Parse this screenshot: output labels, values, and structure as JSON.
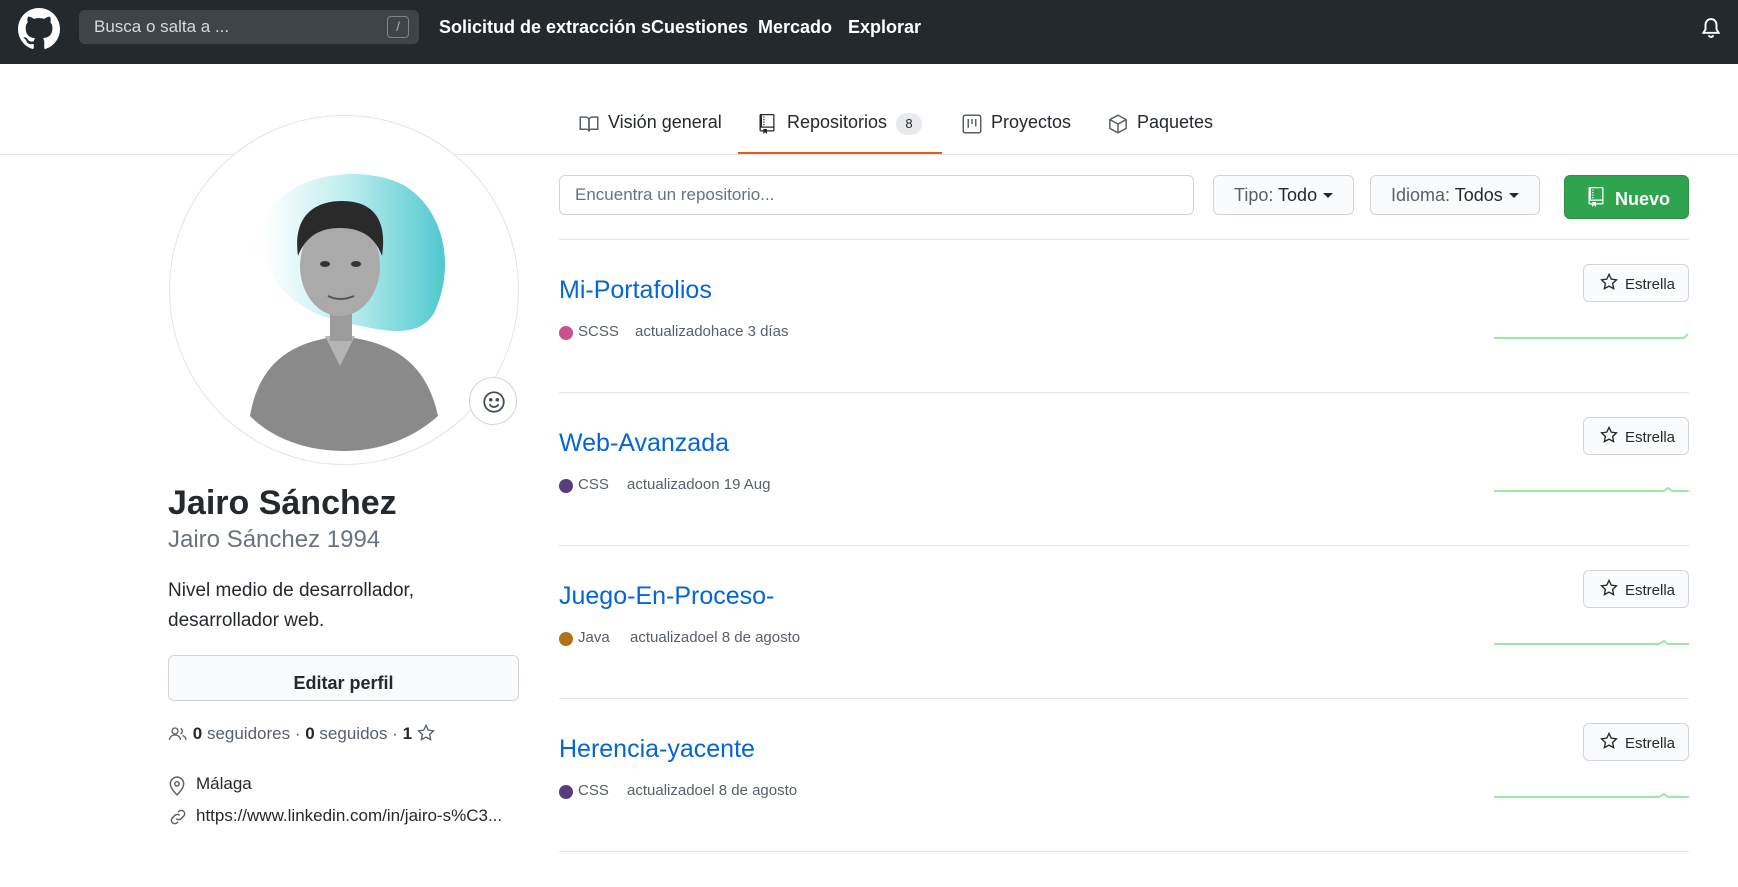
{
  "header": {
    "search_placeholder": "Busca o salta a ...",
    "slash_key": "/",
    "nav": [
      "Solicitud de extracción s",
      "Cuestiones",
      "Mercado",
      "Explorar"
    ]
  },
  "tabs": [
    {
      "label": "Visión general",
      "icon": "book-icon"
    },
    {
      "label": "Repositorios",
      "icon": "repo-icon",
      "count": "8"
    },
    {
      "label": "Proyectos",
      "icon": "project-icon"
    },
    {
      "label": "Paquetes",
      "icon": "package-icon"
    }
  ],
  "profile": {
    "full_name": "Jairo Sánchez",
    "username": "Jairo Sánchez 1994",
    "bio": "Nivel medio de desarrollador, desarrollador web.",
    "edit_label": "Editar perfil",
    "followers_count": "0",
    "followers_label": "seguidores",
    "separator": " · ",
    "following_count": "0",
    "following_label": "seguidos",
    "stars_count": "1",
    "location": "Málaga",
    "website": "https://www.linkedin.com/in/jairo-s%C3..."
  },
  "repos_toolbar": {
    "search_placeholder": "Encuentra un repositorio...",
    "type_label": "Tipo:",
    "type_value": "Todo",
    "lang_label": "Idioma:",
    "lang_value": "Todos",
    "new_label": "Nuevo"
  },
  "repos": [
    {
      "name": "Mi-Portafolios",
      "language": "SCSS",
      "lang_color": "#c6538c",
      "updated": "actualizadohace 3 días",
      "star_label": "Estrella"
    },
    {
      "name": "Web-Avanzada",
      "language": "CSS",
      "lang_color": "#563d7c",
      "updated": "actualizadoon 19 Aug",
      "star_label": "Estrella"
    },
    {
      "name": "Juego-En-Proceso-",
      "language": "Java",
      "lang_color": "#b07219",
      "updated": "actualizadoel 8 de agosto",
      "star_label": "Estrella"
    },
    {
      "name": "Herencia-yacente",
      "language": "CSS",
      "lang_color": "#563d7c",
      "updated": "actualizadoel 8 de agosto",
      "star_label": "Estrella"
    }
  ],
  "colors": {
    "header_bg": "#24292e",
    "link": "#0366d6",
    "primary_button": "#2ea44f",
    "active_tab_underline": "#e36209",
    "sparkline": "#9be9a8"
  }
}
